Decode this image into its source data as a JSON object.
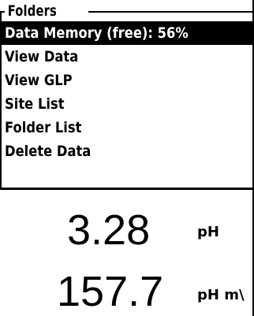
{
  "panel": {
    "title": "Folders"
  },
  "menu": {
    "items": [
      {
        "label": "Data Memory (free): 56%",
        "selected": true
      },
      {
        "label": "View Data",
        "selected": false
      },
      {
        "label": "View GLP",
        "selected": false
      },
      {
        "label": "Site List",
        "selected": false
      },
      {
        "label": "Folder List",
        "selected": false
      },
      {
        "label": "Delete Data",
        "selected": false
      }
    ]
  },
  "readings": [
    {
      "value": "3.28",
      "unit": "pH"
    },
    {
      "value": "157.7",
      "unit": "pH m\\"
    }
  ],
  "colors": {
    "background": "#ffffff",
    "foreground": "#000000",
    "selection_bg": "#000000",
    "selection_fg": "#ffffff"
  }
}
